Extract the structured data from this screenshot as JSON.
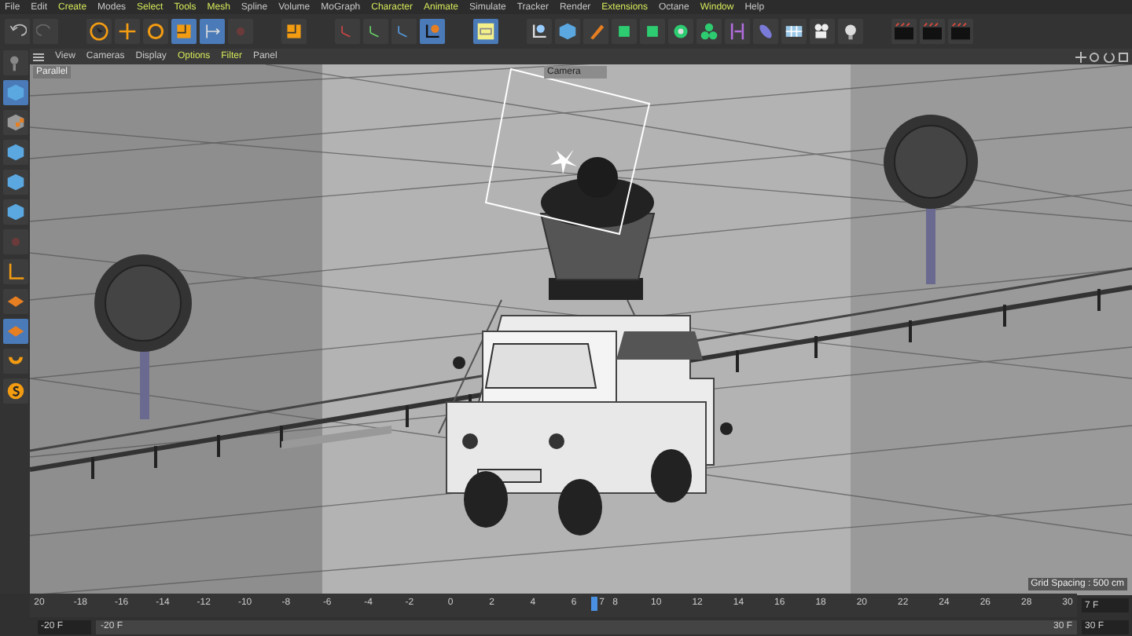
{
  "menu_bar": [
    {
      "label": "File",
      "highlighted": false
    },
    {
      "label": "Edit",
      "highlighted": false
    },
    {
      "label": "Create",
      "highlighted": true
    },
    {
      "label": "Modes",
      "highlighted": false
    },
    {
      "label": "Select",
      "highlighted": true
    },
    {
      "label": "Tools",
      "highlighted": true
    },
    {
      "label": "Mesh",
      "highlighted": true
    },
    {
      "label": "Spline",
      "highlighted": false
    },
    {
      "label": "Volume",
      "highlighted": false
    },
    {
      "label": "MoGraph",
      "highlighted": false
    },
    {
      "label": "Character",
      "highlighted": true
    },
    {
      "label": "Animate",
      "highlighted": true
    },
    {
      "label": "Simulate",
      "highlighted": false
    },
    {
      "label": "Tracker",
      "highlighted": false
    },
    {
      "label": "Render",
      "highlighted": false
    },
    {
      "label": "Extensions",
      "highlighted": true
    },
    {
      "label": "Octane",
      "highlighted": false
    },
    {
      "label": "Window",
      "highlighted": true
    },
    {
      "label": "Help",
      "highlighted": false
    }
  ],
  "toolbar": [
    {
      "kind": "undo",
      "selected": false
    },
    {
      "kind": "redo",
      "selected": false
    },
    {
      "kind": "gap"
    },
    {
      "kind": "select",
      "selected": false
    },
    {
      "kind": "move",
      "selected": false
    },
    {
      "kind": "rotate",
      "selected": false
    },
    {
      "kind": "scale",
      "selected": true
    },
    {
      "kind": "transform",
      "selected": true
    },
    {
      "kind": "dim",
      "selected": false
    },
    {
      "kind": "gap"
    },
    {
      "kind": "scale",
      "selected": false
    },
    {
      "kind": "gap"
    },
    {
      "kind": "axis-x",
      "selected": false
    },
    {
      "kind": "axis-y",
      "selected": false
    },
    {
      "kind": "axis-z",
      "selected": false
    },
    {
      "kind": "coords",
      "selected": true
    },
    {
      "kind": "gap"
    },
    {
      "kind": "panel",
      "selected": true
    },
    {
      "kind": "gap"
    },
    {
      "kind": "spline",
      "selected": false
    },
    {
      "kind": "cube",
      "selected": false
    },
    {
      "kind": "pen",
      "selected": false
    },
    {
      "kind": "green",
      "selected": false
    },
    {
      "kind": "green",
      "selected": false
    },
    {
      "kind": "gear",
      "selected": false
    },
    {
      "kind": "cluster",
      "selected": false
    },
    {
      "kind": "deformer",
      "selected": false
    },
    {
      "kind": "capsule",
      "selected": false
    },
    {
      "kind": "floor",
      "selected": false
    },
    {
      "kind": "camera",
      "selected": false
    },
    {
      "kind": "light",
      "selected": false
    },
    {
      "kind": "gap"
    },
    {
      "kind": "clapper",
      "selected": false
    },
    {
      "kind": "clapper",
      "selected": false
    },
    {
      "kind": "clapper",
      "selected": false
    }
  ],
  "left_toolbar": [
    {
      "kind": "object",
      "selected": false
    },
    {
      "kind": "cube",
      "selected": true
    },
    {
      "kind": "checker",
      "selected": false
    },
    {
      "kind": "cube",
      "selected": false
    },
    {
      "kind": "cube",
      "selected": false
    },
    {
      "kind": "cube",
      "selected": false
    },
    {
      "kind": "dim",
      "selected": false
    },
    {
      "kind": "axis",
      "selected": false
    },
    {
      "kind": "plane",
      "selected": false
    },
    {
      "kind": "plane",
      "selected": true
    },
    {
      "kind": "magnet",
      "selected": false
    },
    {
      "kind": "snap",
      "selected": false
    }
  ],
  "viewport": {
    "menu": [
      {
        "label": "View",
        "highlighted": false
      },
      {
        "label": "Cameras",
        "highlighted": false
      },
      {
        "label": "Display",
        "highlighted": false
      },
      {
        "label": "Options",
        "highlighted": true
      },
      {
        "label": "Filter",
        "highlighted": true
      },
      {
        "label": "Panel",
        "highlighted": false
      }
    ],
    "projection": "Parallel",
    "camera": "Camera",
    "grid_spacing": "Grid Spacing : 500 cm"
  },
  "timeline": {
    "ticks": [
      "20",
      "-18",
      "-16",
      "-14",
      "-12",
      "-10",
      "-8",
      "-6",
      "-4",
      "-2",
      "0",
      "2",
      "4",
      "6",
      "8",
      "10",
      "12",
      "14",
      "16",
      "18",
      "20",
      "22",
      "24",
      "26",
      "28",
      "30"
    ],
    "current_frame": "7",
    "level": 0.54,
    "start_field": "-20 F",
    "range_start": "-20 F",
    "range_end": "30 F",
    "frame_field": "7 F",
    "end_field": "30 F"
  }
}
